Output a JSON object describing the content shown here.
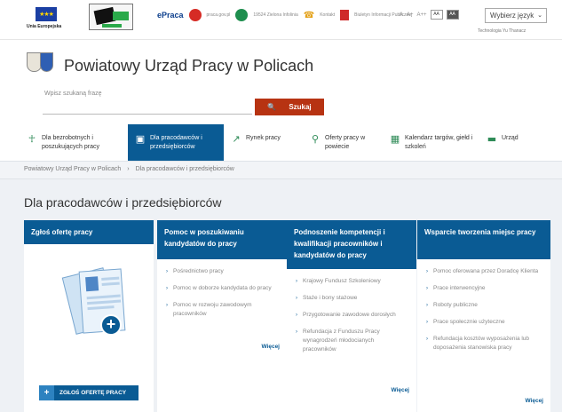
{
  "topbar": {
    "eu_label": "Unia Europejska",
    "eu_stars": "★★★",
    "epraca": "ePraca",
    "links": [
      {
        "label": "praca.gov.pl",
        "icon": "praca-gov-icon"
      },
      {
        "label": "19524 Zielona Infolinia",
        "icon": "infolinia-icon"
      },
      {
        "label": "Kontakt",
        "icon": "phone-icon"
      },
      {
        "label": "Biuletyn Informacji Publicznej",
        "icon": "bip-icon"
      }
    ],
    "font_sizes": [
      "A",
      "A+",
      "A++"
    ],
    "contrast": [
      "AA",
      "AA"
    ],
    "language_select": "Wybierz język",
    "tech_text": "Technologia Yu Thanacz"
  },
  "header": {
    "site_title": "Powiatowy Urząd Pracy w Policach",
    "search_label": "Wpisz szukaną frazę",
    "search_button": "Szukaj"
  },
  "nav": [
    {
      "label": "Dla bezrobotnych i poszukujących pracy",
      "icon": "person-icon",
      "active": false
    },
    {
      "label": "Dla pracodawców i przedsiębiorców",
      "icon": "briefcase-icon",
      "active": true
    },
    {
      "label": "Rynek pracy",
      "icon": "chart-icon",
      "active": false
    },
    {
      "label": "Oferty pracy w powiecie",
      "icon": "search-icon",
      "active": false
    },
    {
      "label": "Kalendarz targów, giełd i szkoleń",
      "icon": "calendar-icon",
      "active": false
    },
    {
      "label": "Urząd",
      "icon": "office-icon",
      "active": false
    }
  ],
  "breadcrumb": [
    "Powiatowy Urząd Pracy w Policach",
    "Dla pracodawców i przedsiębiorców"
  ],
  "page_title": "Dla pracodawców i przedsiębiorców",
  "cards": [
    {
      "title": "Zgłoś ofertę pracy",
      "button": "ZGŁOŚ OFERTĘ PRACY"
    },
    {
      "title": "Pomoc w poszukiwaniu kandydatów do pracy",
      "items": [
        "Pośrednictwo pracy",
        "Pomoc w doborze kandydata do pracy",
        "Pomoc w rozwoju zawodowym pracowników"
      ],
      "more": "Więcej"
    },
    {
      "title": "Podnoszenie kompetencji i kwalifikacji pracowników i kandydatów do pracy",
      "items": [
        "Krajowy Fundusz Szkoleniowy",
        "Staże i bony stażowe",
        "Przygotowanie zawodowe dorosłych",
        "Refundacja z Funduszu Pracy wynagrodzeń młodocianych pracowników"
      ],
      "more": "Więcej"
    },
    {
      "title": "Wsparcie tworzenia miejsc pracy",
      "items": [
        "Pomoc oferowana przez Doradcę Klienta",
        "Prace interwencyjne",
        "Roboty publiczne",
        "Prace społecznie użyteczne",
        "Refundacja kosztów wyposażenia lub doposażenia stanowiska pracy"
      ],
      "more": "Więcej"
    }
  ]
}
